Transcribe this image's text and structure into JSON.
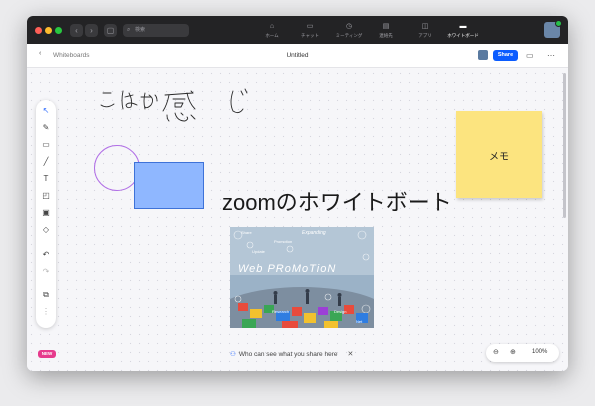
{
  "titlebar": {
    "search_placeholder": "検索",
    "tabs": [
      {
        "label": "ホーム",
        "icon": "home-icon"
      },
      {
        "label": "チャット",
        "icon": "chat-icon"
      },
      {
        "label": "ミーティング",
        "icon": "clock-icon"
      },
      {
        "label": "連絡先",
        "icon": "contacts-icon"
      },
      {
        "label": "アプリ",
        "icon": "apps-icon"
      },
      {
        "label": "ホワイトボード",
        "icon": "whiteboard-icon",
        "active": true
      }
    ]
  },
  "header": {
    "breadcrumb": "Whiteboards",
    "title": "Untitled",
    "share_label": "Share"
  },
  "canvas": {
    "handwriting": "こんな感じ",
    "big_text": "zoomのホワイトボート",
    "sticky_note": "メモ",
    "photo": {
      "banner": "Web PRoMoTioN",
      "words": [
        "Share",
        "Expanding",
        "Promotion",
        "Update",
        "Research",
        "Design",
        "Net"
      ]
    }
  },
  "footer": {
    "new_badge": "NEW",
    "who_can_see": "Who can see what you share here",
    "zoom_level": "100%"
  },
  "colors": {
    "accent": "#0b5cff",
    "sticky": "#fce47f",
    "rect_fill": "#8fb7ff",
    "circle_stroke": "#b16fe6",
    "badge": "#e63a8c"
  }
}
